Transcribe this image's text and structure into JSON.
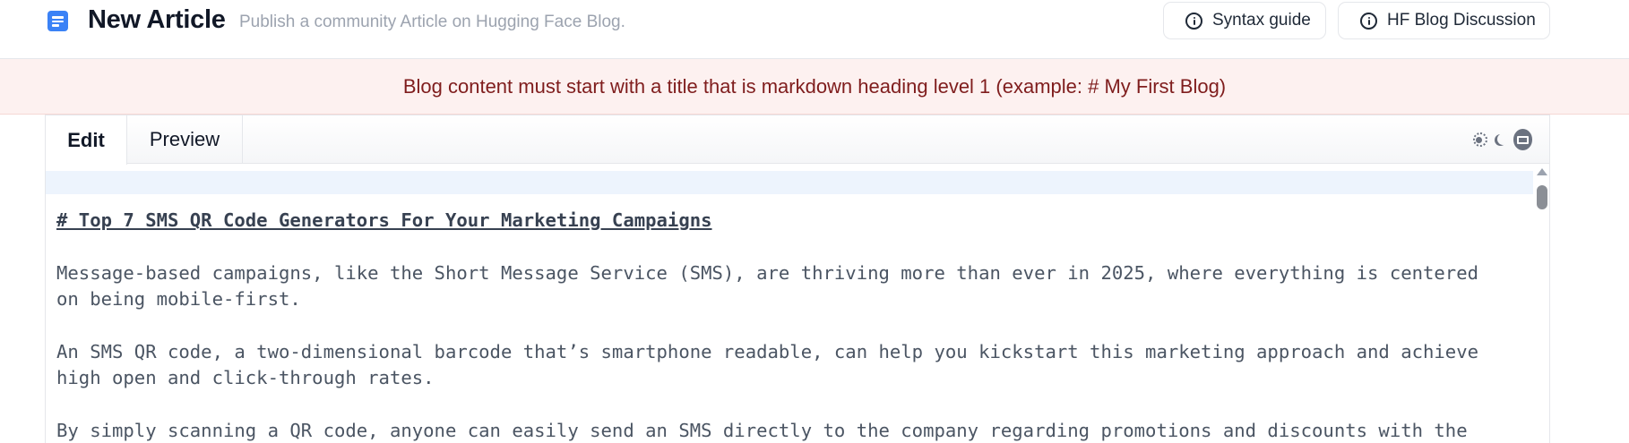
{
  "header": {
    "title": "New Article",
    "subtitle": "Publish a community Article on Hugging Face Blog.",
    "buttons": [
      {
        "label": "Syntax guide",
        "icon": "info-icon"
      },
      {
        "label": "HF Blog Discussion",
        "icon": "info-icon"
      }
    ]
  },
  "banner": {
    "message": "Blog content must start with a title that is markdown heading level 1 (example: # My First Blog)"
  },
  "editor": {
    "tabs": [
      {
        "label": "Edit",
        "active": true
      },
      {
        "label": "Preview",
        "active": false
      }
    ],
    "theme_options": [
      "sun-icon",
      "moon-icon",
      "system-icon"
    ],
    "lines": {
      "heading": "# Top 7 SMS QR Code Generators For Your Marketing Campaigns",
      "p1_line1": "Message-based campaigns, like the Short Message Service (SMS), are thriving more than ever in 2025, where everything is centered",
      "p1_line2": "on being mobile-first.",
      "p2_line1": "An SMS QR code, a two-dimensional barcode that’s smartphone readable, can help you kickstart this marketing approach and achieve",
      "p2_line2": "high open and click-through rates.",
      "p3_line1": "By simply scanning a QR code, anyone can easily send an SMS directly to the company regarding promotions and discounts with the"
    }
  },
  "colors": {
    "accent": "#3b82f6",
    "banner_bg": "#fdf1f0",
    "banner_text": "#7f1d1d",
    "active_line": "#edf4fd"
  }
}
